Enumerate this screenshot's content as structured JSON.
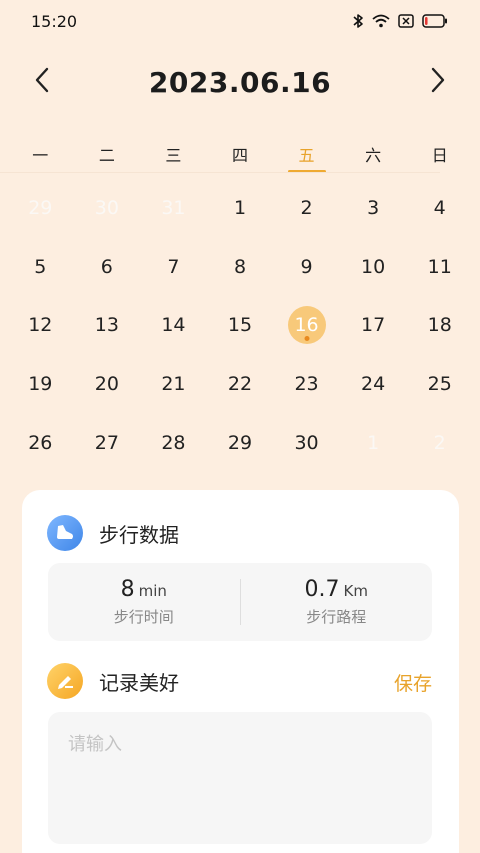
{
  "status_bar": {
    "time": "15:20",
    "icons": [
      "bluetooth-icon",
      "wifi-icon",
      "sim-disabled-icon",
      "battery-low-icon"
    ],
    "battery_level": 0.15
  },
  "header": {
    "title": "2023.06.16",
    "prev_icon": "chevron-left-icon",
    "next_icon": "chevron-right-icon"
  },
  "weekdays": [
    "一",
    "二",
    "三",
    "四",
    "五",
    "六",
    "日"
  ],
  "active_weekday": "五",
  "days": [
    "29",
    "30",
    "31",
    "1",
    "2",
    "3",
    "4",
    "5",
    "6",
    "7",
    "8",
    "9",
    "10",
    "11",
    "12",
    "13",
    "14",
    "15",
    "16",
    "17",
    "18",
    "19",
    "20",
    "21",
    "22",
    "23",
    "24",
    "25",
    "26",
    "27",
    "28",
    "29",
    "30",
    "1",
    "2"
  ],
  "muted_days_indices": [
    0,
    1,
    2,
    33,
    34
  ],
  "selected_day": "16",
  "walking": {
    "title": "步行数据",
    "icon": "shoe-icon",
    "time_value": "8",
    "time_unit": "min",
    "time_label": "步行时间",
    "distance_value": "0.7",
    "distance_unit": "Km",
    "distance_label": "步行路程"
  },
  "record": {
    "title": "记录美好",
    "icon": "pen-icon",
    "save_label": "保存",
    "placeholder": "请输入",
    "value": ""
  },
  "colors": {
    "background": "#fdeee0",
    "accent": "#e8a32b",
    "selected_circle": "#f8c97a"
  }
}
